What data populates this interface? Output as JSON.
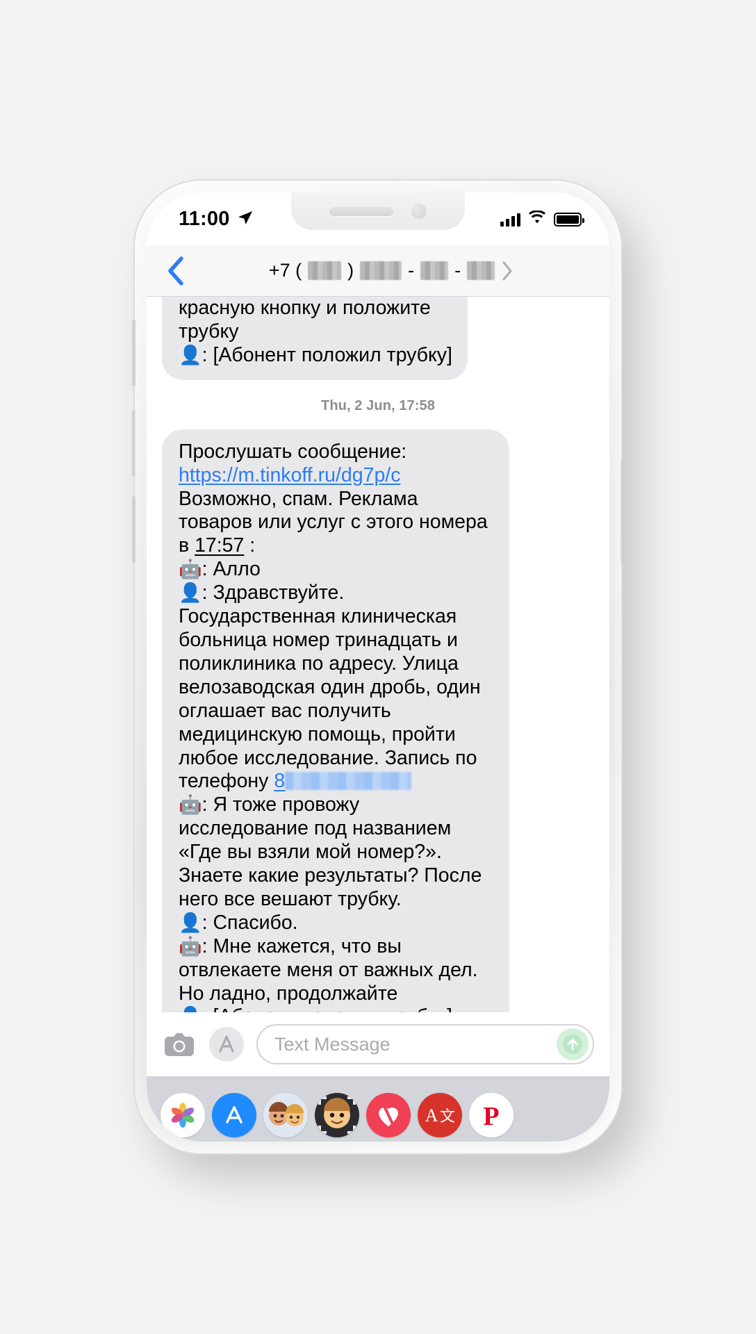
{
  "status_bar": {
    "time": "11:00",
    "location_icon": "location-arrow-icon",
    "signal_icon": "cellular-signal-icon",
    "wifi_icon": "wifi-icon",
    "battery_icon": "battery-full-icon"
  },
  "nav": {
    "back_icon": "back-chevron-icon",
    "title_prefix": "+7 (",
    "title_mid": ")",
    "title_sep": "-",
    "forward_icon": "forward-chevron-icon"
  },
  "thread": {
    "clipped_bubble": {
      "line1": "красную кнопку и положите",
      "line2": "трубку",
      "line3_emoji": "👤",
      "line3_text": ": [Абонент положил трубку]"
    },
    "timestamp_divider": "Thu, 2 Jun, 17:58",
    "bubble": {
      "intro": "Прослушать сообщение:",
      "url": "https://m.tinkoff.ru/dg7p/c",
      "spam_notice_a": "Возможно, спам. Реклама товаров или услуг с этого номера в ",
      "spam_time": "17:57",
      "spam_notice_b": " :",
      "transcript": [
        {
          "speaker_icon": "🤖",
          "text": ": Алло"
        },
        {
          "speaker_icon": "👤",
          "text": ": Здравствуйте. Государственная клиническая больница номер тринадцать и поликлиника по адресу. Улица велозаводская один дробь, один оглашает вас получить медицинскую помощь, пройти любое исследование. Запись по телефону "
        },
        {
          "phone_prefix": "8",
          "phone_redacted": true
        },
        {
          "speaker_icon": "🤖",
          "text": ": Я тоже провожу исследование под названием «Где вы взяли мой номер?». Знаете какие результаты? После него все вешают трубку."
        },
        {
          "speaker_icon": "👤",
          "text": ": Спасибо."
        },
        {
          "speaker_icon": "🤖",
          "text": ": Мне кажется, что вы отвлекаете меня от важных дел. Но ладно, продолжайте"
        },
        {
          "speaker_icon": "👤",
          "text": ": [Абонент положил трубку]"
        }
      ]
    }
  },
  "input_bar": {
    "camera_icon": "camera-icon",
    "appstore_icon": "app-store-icon",
    "placeholder": "Text Message",
    "send_icon": "send-arrow-icon"
  },
  "app_drawer": {
    "items": [
      {
        "name": "photos-app-icon",
        "glyph": "❀"
      },
      {
        "name": "app-store-app-icon",
        "glyph": "A"
      },
      {
        "name": "memoji-stickers-icon",
        "glyph": "🧑‍🎤"
      },
      {
        "name": "animoji-icon",
        "glyph": "🐵"
      },
      {
        "name": "digital-touch-icon",
        "glyph": "💗"
      },
      {
        "name": "translate-icon",
        "glyph": "A文"
      },
      {
        "name": "pinterest-icon",
        "glyph": "P"
      }
    ]
  },
  "home_indicator": "home-indicator"
}
